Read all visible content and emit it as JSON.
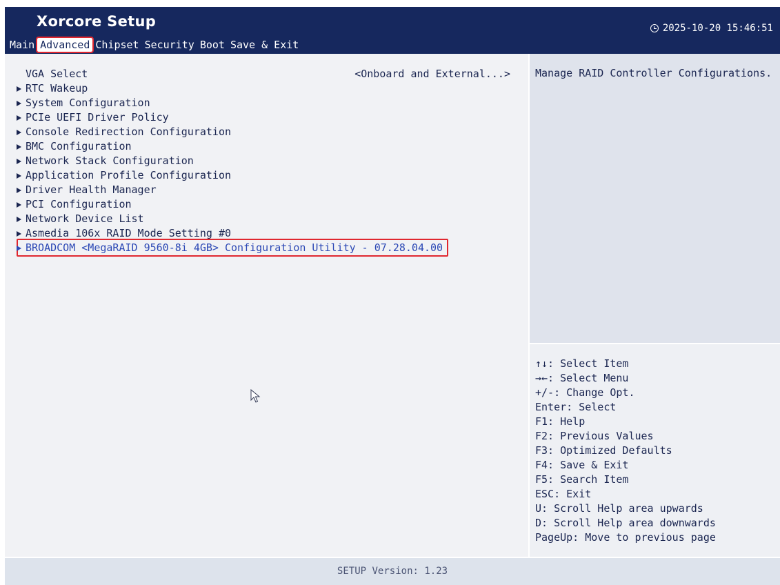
{
  "header": {
    "app_title": "Xorcore Setup",
    "datetime": "2025-10-20 15:46:51",
    "tabs": [
      {
        "label": "Main",
        "active": false
      },
      {
        "label": "Advanced",
        "active": true
      },
      {
        "label": "Chipset",
        "active": false
      },
      {
        "label": "Security",
        "active": false
      },
      {
        "label": "Boot",
        "active": false
      },
      {
        "label": "Save & Exit",
        "active": false
      }
    ]
  },
  "menu": {
    "items": [
      {
        "label": "VGA Select",
        "submenu": false,
        "value": "<Onboard and External...>"
      },
      {
        "label": "RTC Wakeup",
        "submenu": true
      },
      {
        "label": "System Configuration",
        "submenu": true
      },
      {
        "label": "PCIe UEFI Driver Policy",
        "submenu": true
      },
      {
        "label": "Console Redirection Configuration",
        "submenu": true
      },
      {
        "label": "BMC Configuration",
        "submenu": true
      },
      {
        "label": "Network Stack Configuration",
        "submenu": true
      },
      {
        "label": "Application Profile Configuration",
        "submenu": true
      },
      {
        "label": "Driver Health Manager",
        "submenu": true
      },
      {
        "label": "PCI Configuration",
        "submenu": true
      },
      {
        "label": "Network Device List",
        "submenu": true
      },
      {
        "label": "Asmedia 106x RAID Mode Setting #0",
        "submenu": true
      },
      {
        "label": "BROADCOM <MegaRAID 9560-8i 4GB> Configuration Utility - 07.28.04.00",
        "submenu": true,
        "selected": true
      }
    ]
  },
  "help": {
    "text": "Manage RAID Controller Configurations."
  },
  "keys": [
    "↑↓: Select Item",
    "→←: Select Menu",
    "+/-: Change Opt.",
    "Enter: Select",
    "F1: Help",
    "F2: Previous Values",
    "F3: Optimized Defaults",
    "F4: Save & Exit",
    "F5: Search Item",
    "ESC: Exit",
    "U: Scroll Help area upwards",
    "D: Scroll Help area downwards",
    "PageUp: Move to previous page"
  ],
  "footer": {
    "version": "SETUP Version: 1.23"
  },
  "colors": {
    "header_bg": "#16285e",
    "highlight_border": "#e0272f",
    "selected_text": "#2c48b5"
  }
}
